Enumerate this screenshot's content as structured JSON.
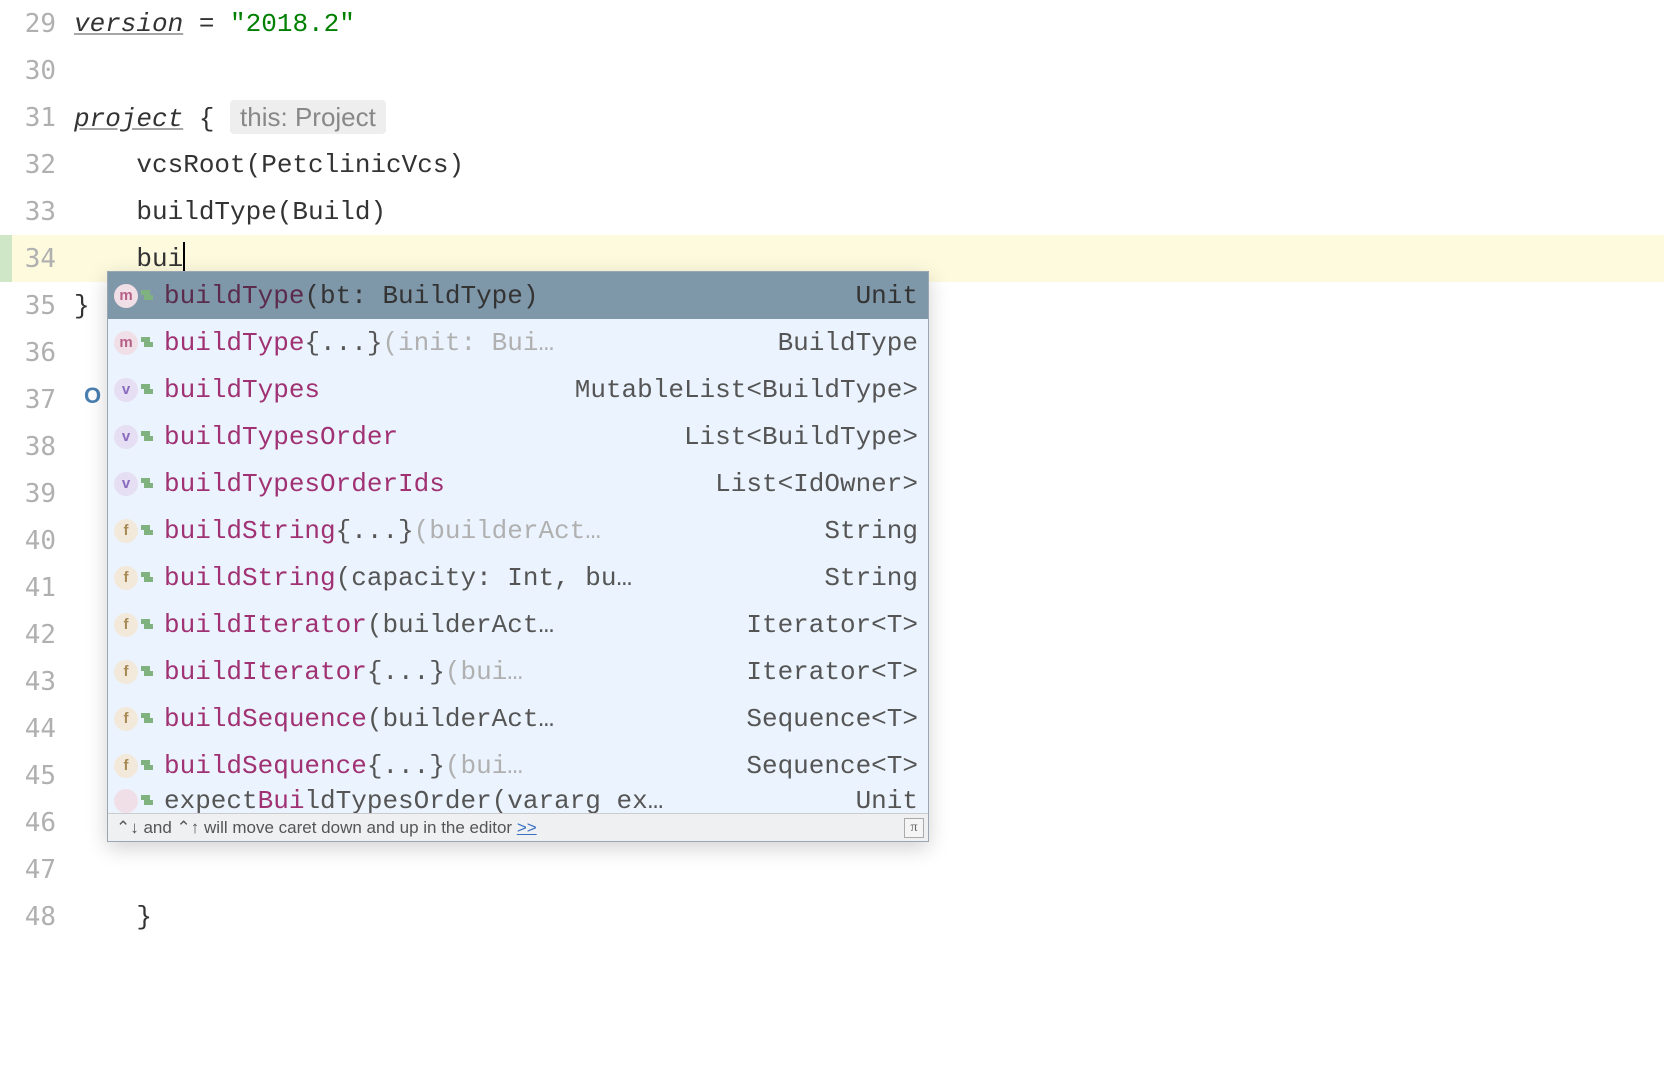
{
  "lines_start": 29,
  "code_lines": [
    {
      "num": 29,
      "tokens": [
        {
          "t": "version",
          "cls": "kw-italic"
        },
        {
          "t": " = ",
          "cls": "op"
        },
        {
          "t": "\"2018.2\"",
          "cls": "string"
        }
      ]
    },
    {
      "num": 30,
      "tokens": []
    },
    {
      "num": 31,
      "tokens": [
        {
          "t": "project",
          "cls": "kw-italic"
        },
        {
          "t": " { ",
          "cls": "op"
        }
      ],
      "hint": "this: Project"
    },
    {
      "num": 32,
      "tokens": [
        {
          "t": "    vcsRoot(PetclinicVcs)",
          "cls": "ident"
        }
      ]
    },
    {
      "num": 33,
      "tokens": [
        {
          "t": "    buildType(Build)",
          "cls": "ident"
        }
      ]
    },
    {
      "num": 34,
      "active": true,
      "tokens": [
        {
          "t": "    bui",
          "cls": "ident"
        }
      ],
      "caret": true
    },
    {
      "num": 35,
      "tokens": [
        {
          "t": "}",
          "cls": "op"
        }
      ]
    },
    {
      "num": 36,
      "tokens": []
    },
    {
      "num": 37,
      "tokens": [],
      "override": true
    },
    {
      "num": 38,
      "tokens": []
    },
    {
      "num": 39,
      "tokens": []
    },
    {
      "num": 40,
      "tokens": []
    },
    {
      "num": 41,
      "tokens": []
    },
    {
      "num": 42,
      "tokens": []
    },
    {
      "num": 43,
      "tokens": []
    },
    {
      "num": 44,
      "tokens": []
    },
    {
      "num": 45,
      "tokens": []
    },
    {
      "num": 46,
      "tokens": []
    },
    {
      "num": 47,
      "tokens": []
    },
    {
      "num": 48,
      "tokens": [
        {
          "t": "    }",
          "cls": "op"
        }
      ]
    }
  ],
  "typed_prefix": "bui",
  "completion": {
    "items": [
      {
        "kind": "m",
        "name": "bui",
        "rest": "ldType",
        "sig": "(bt: BuildType)",
        "extra": "",
        "ret": "Unit",
        "selected": true
      },
      {
        "kind": "m",
        "name": "bui",
        "rest": "ldType",
        "sig": " {...}",
        "extra": " (init: Bui…",
        "ret": "BuildType"
      },
      {
        "kind": "v",
        "name": "bui",
        "rest": "ldTypes",
        "sig": "",
        "extra": "",
        "ret": "MutableList<BuildType>"
      },
      {
        "kind": "v",
        "name": "bui",
        "rest": "ldTypesOrder",
        "sig": "",
        "extra": "",
        "ret": "List<BuildType>"
      },
      {
        "kind": "v",
        "name": "bui",
        "rest": "ldTypesOrderIds",
        "sig": "",
        "extra": "",
        "ret": "List<IdOwner>"
      },
      {
        "kind": "f",
        "name": "bui",
        "rest": "ldString",
        "sig": " {...}",
        "extra": " (builderAct…",
        "ret": "String"
      },
      {
        "kind": "f",
        "name": "bui",
        "rest": "ldString",
        "sig": "(capacity: Int, bu…",
        "extra": "",
        "ret": "String"
      },
      {
        "kind": "f",
        "name": "bui",
        "rest": "ldIterator",
        "sig": "(builderAct…",
        "extra": "",
        "ret": "Iterator<T>"
      },
      {
        "kind": "f",
        "name": "bui",
        "rest": "ldIterator",
        "sig": " {...}",
        "extra": " (bui…",
        "ret": "Iterator<T>"
      },
      {
        "kind": "f",
        "name": "bui",
        "rest": "ldSequence",
        "sig": "(builderAct…",
        "extra": "",
        "ret": "Sequence<T>"
      },
      {
        "kind": "f",
        "name": "bui",
        "rest": "ldSequence",
        "sig": " {...}",
        "extra": " (bui…",
        "ret": "Sequence<T>"
      }
    ],
    "partial": {
      "name_pre": "expect",
      "name_hi": "Bui",
      "rest": "ldTypesOrder(vararg ex…",
      "ret": "Unit"
    },
    "footer": "⌃↓ and ⌃↑ will move caret down and up in the editor ",
    "footer_link": ">>",
    "pi": "π"
  }
}
